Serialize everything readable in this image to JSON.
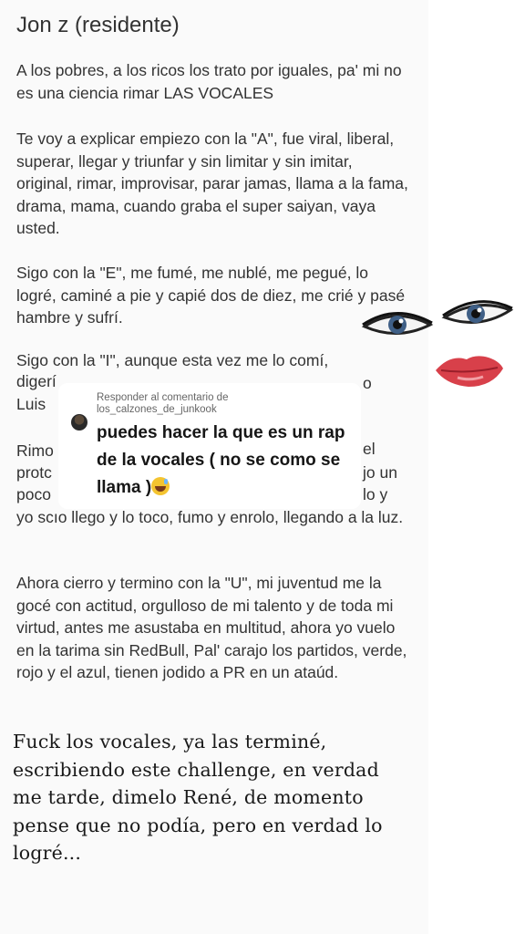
{
  "document": {
    "title": "Jon z (residente)",
    "paragraphs": [
      "A los pobres, a los ricos los trato por iguales, pa' mi no es una ciencia rimar LAS VOCALES",
      "Te voy a explicar empiezo con la \"A\", fue viral, liberal, superar, llegar y triunfar y sin limitar y sin imitar, original, rimar, improvisar, parar jamas, llama a la fama, drama, mama, cuando graba el super saiyan, vaya usted.",
      "Sigo con la \"E\", me fumé, me nublé, me pegué, lo logré, caminé a pie y capié dos de diez, me crié y pasé hambre y sufrí.",
      "Sigo con la \"I\", aunque esta vez me lo comí,",
      "yo scıo llego y lo toco, fumo y enrolo, llegando a la luz.",
      "Ahora cierro y termino con la \"U\", mi juventud me la gocé con actitud, orgulloso de mi talento y de toda mi virtud, antes me asustaba en multitud, ahora yo vuelo en la tarima sin RedBull, Pal' carajo los partidos, verde, rojo y el azul, tienen jodido a PR en un ataúd."
    ],
    "fragments": {
      "l1": "digerí",
      "l2": "Luis",
      "r1": "o",
      "l3": "Rimo",
      "r3": "el",
      "l4": "protc",
      "r4": "jo un",
      "l5": "poco",
      "r5": "lo y"
    },
    "handwritten": "Fuck los vocales, ya las terminé, escribiendo este challenge, en verdad me tarde, dimelo René, de momento pense que no podía, pero en verdad lo logré..."
  },
  "comment": {
    "reply_label": "Responder al comentario de",
    "username": "los_calzones_de_junkook",
    "text": "puedes hacer la que es un rap de la vocales ( no se como se llama )",
    "emoji": "grinning-sweat-emoji"
  },
  "colors": {
    "text": "#333333",
    "card": "#ffffff",
    "lips": "#d8404a",
    "iris": "#3f5f86"
  }
}
